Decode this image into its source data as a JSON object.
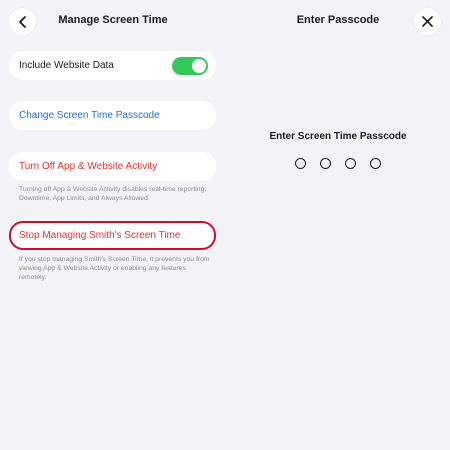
{
  "left": {
    "title": "Manage Screen Time",
    "include_website_data": {
      "label": "Include Website Data",
      "enabled": true
    },
    "change_passcode_label": "Change Screen Time Passcode",
    "turn_off_label": "Turn Off App & Website Activity",
    "turn_off_note": "Turning off App & Website Activity disables real-time reporting, Downtime, App Limits, and Always Allowed.",
    "stop_label": "Stop Managing Smith's Screen Time",
    "stop_note": "If you stop managing Smith's Screen Time, it prevents you from viewing App & Website Activity or enabling any features remotely."
  },
  "right": {
    "title": "Enter Passcode",
    "prompt": "Enter Screen Time Passcode",
    "passcode_length": 4
  },
  "icons": {
    "back": "chevron-left-icon",
    "close": "close-icon"
  },
  "colors": {
    "background": "#f2f2f7",
    "link_blue": "#1f6fd6",
    "destructive_red": "#e0312f",
    "toggle_green": "#34c759",
    "highlight_border": "#c8102e"
  }
}
